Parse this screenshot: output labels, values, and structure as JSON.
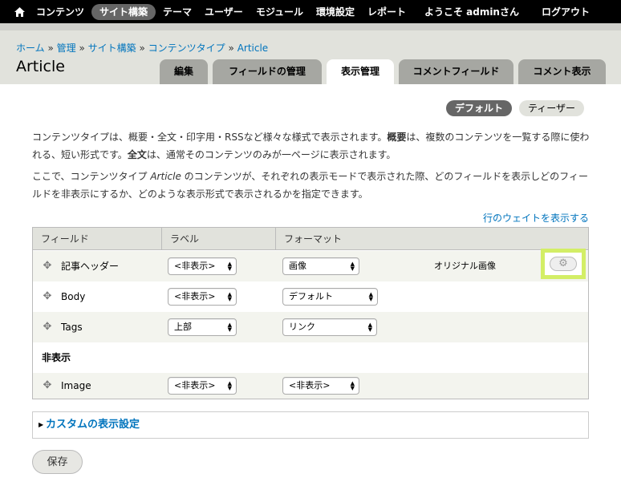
{
  "toolbar": {
    "items": [
      "コンテンツ",
      "サイト構築",
      "テーマ",
      "ユーザー",
      "モジュール",
      "環境設定",
      "レポート"
    ],
    "active_index": 1,
    "welcome": "ようこそ adminさん",
    "logout": "ログアウト"
  },
  "breadcrumb": {
    "items": [
      "ホーム",
      "管理",
      "サイト構築",
      "コンテンツタイプ",
      "Article"
    ],
    "separator": "»"
  },
  "page_title": "Article",
  "tabs": [
    {
      "label": "編集"
    },
    {
      "label": "フィールドの管理"
    },
    {
      "label": "表示管理"
    },
    {
      "label": "コメントフィールド"
    },
    {
      "label": "コメント表示"
    }
  ],
  "active_tab": 2,
  "subtabs": [
    {
      "label": "デフォルト"
    },
    {
      "label": "ティーザー"
    }
  ],
  "description": {
    "p1_a": "コンテンツタイプは、概要・全文・印字用・RSSなど様々な様式で表示されます。",
    "p1_b": "概要",
    "p1_c": "は、複数のコンテンツを一覧する際に使われる、短い形式です。",
    "p1_d": "全文",
    "p1_e": "は、通常そのコンテンツのみが一ページに表示されます。",
    "p2_a": "ここで、コンテンツタイプ ",
    "p2_b": "Article",
    "p2_c": " のコンテンツが、それぞれの表示モードで表示された際、どのフィールドを表示しどのフィールドを非表示にするか、どのような表示形式で表示されるかを指定できます。"
  },
  "weight_link": "行のウェイトを表示する",
  "table": {
    "headers": [
      "フィールド",
      "ラベル",
      "フォーマット"
    ],
    "rows": [
      {
        "field": "記事ヘッダー",
        "label": "<非表示>",
        "format": "画像",
        "summary": "オリジナル画像"
      },
      {
        "field": "Body",
        "label": "<非表示>",
        "format": "デフォルト"
      },
      {
        "field": "Tags",
        "label": "上部",
        "format": "リンク"
      }
    ],
    "hidden_section": "非表示",
    "hidden_rows": [
      {
        "field": "Image",
        "label": "<非表示>",
        "format": "<非表示>"
      }
    ]
  },
  "custom_settings": "カスタムの表示設定",
  "save_button": "保存",
  "colors": {
    "link": "#0074bd",
    "toolbar_bg": "#000000",
    "highlight": "#d3ee66"
  }
}
